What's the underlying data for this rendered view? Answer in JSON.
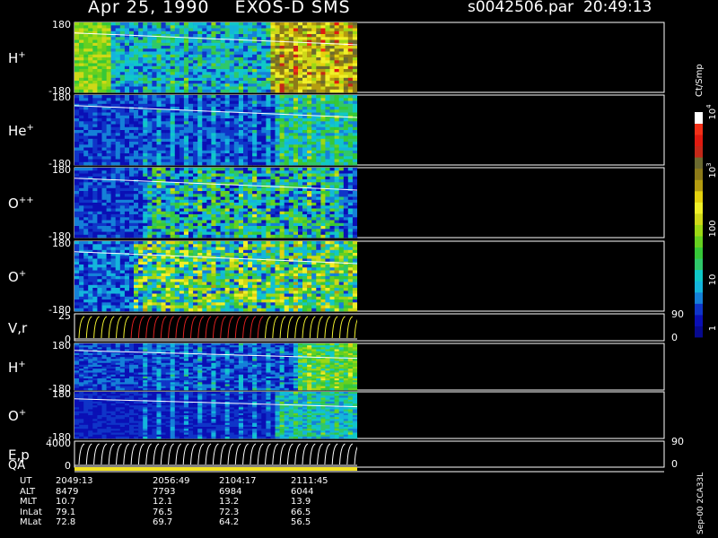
{
  "header": {
    "title_left": "Apr 25, 1990    EXOS-D SMS",
    "title_right": "s0042506.par  20:49:13"
  },
  "panels": [
    {
      "label": "H",
      "sup": "+",
      "ymax": "180",
      "ymin": "-180"
    },
    {
      "label": "He",
      "sup": "+",
      "ymax": "180",
      "ymin": "-180"
    },
    {
      "label": "O",
      "sup": "++",
      "ymax": "180",
      "ymin": "-180"
    },
    {
      "label": "O",
      "sup": "+",
      "ymax": "180",
      "ymin": "-180"
    },
    {
      "label": "V,r",
      "sup": "",
      "ymax": "25",
      "ymin": "0",
      "right_top": "90",
      "right_bottom": "0"
    },
    {
      "label": "H",
      "sup": "+",
      "ymax": "180",
      "ymin": "-180"
    },
    {
      "label": "O",
      "sup": "+",
      "ymax": "180",
      "ymin": "-180"
    },
    {
      "label": "E,p",
      "sup": "",
      "ymax": "4000",
      "ymin": "0",
      "right_top": "90",
      "right_bottom": "0"
    }
  ],
  "qa_label": "QA",
  "colorbar": {
    "unit": "Ct/Smp",
    "ticks": [
      {
        "text": "1",
        "exp": ""
      },
      {
        "text": "10",
        "exp": ""
      },
      {
        "text": "100",
        "exp": ""
      },
      {
        "text": "10",
        "exp": "3"
      },
      {
        "text": "10",
        "exp": "4"
      }
    ],
    "colors": [
      "#07098f",
      "#0a0fb5",
      "#0f35c8",
      "#1580d8",
      "#14b5dc",
      "#10c8c8",
      "#2fc86a",
      "#36c838",
      "#66d020",
      "#9cd814",
      "#cfd818",
      "#f0f028",
      "#e4d10e",
      "#b49c10",
      "#8c7a18",
      "#6b6a30",
      "#c42818",
      "#e01a10",
      "#f23018",
      "#ffffff"
    ]
  },
  "footer": {
    "rows": [
      {
        "name": "UT",
        "values": [
          "2049:13",
          "2056:49",
          "2104:17",
          "2111:45"
        ]
      },
      {
        "name": "ALT",
        "values": [
          "8479",
          "7793",
          "6984",
          "6044"
        ]
      },
      {
        "name": "MLT",
        "values": [
          "10.7",
          "12.1",
          "13.2",
          "13.9"
        ]
      },
      {
        "name": "InLat",
        "values": [
          "79.1",
          "76.5",
          "72.3",
          "66.5"
        ]
      },
      {
        "name": "MLat",
        "values": [
          "72.8",
          "69.7",
          "64.2",
          "56.5"
        ]
      }
    ],
    "code": "Sep-00 2CA33L"
  },
  "chart_data": {
    "type": "heatmap",
    "title": "Apr 25, 1990    EXOS-D SMS",
    "file": "s0042506.par  20:49:13",
    "x_ticks": [
      "2049:13",
      "2056:49",
      "2104:17",
      "2111:45"
    ],
    "panels": [
      "H+",
      "He+",
      "O++",
      "O+",
      "V,r",
      "H+",
      "O+",
      "E,p"
    ],
    "y_range_angle": [
      -180,
      180
    ],
    "y_range_vr": [
      0,
      25
    ],
    "y_range_ep": [
      0,
      4000
    ],
    "colorbar_unit": "Ct/Smp",
    "colorbar_scale": "log",
    "colorbar_ticks": [
      "1",
      "10",
      "100",
      "10^3",
      "10^4"
    ],
    "data_extent_fraction": 0.48
  }
}
